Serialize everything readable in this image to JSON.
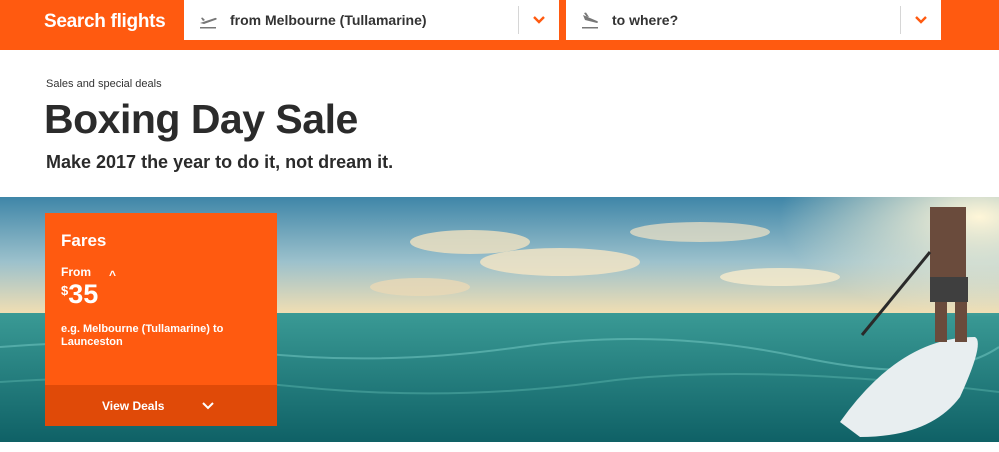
{
  "search": {
    "title": "Search flights",
    "from_value": "from Melbourne (Tullamarine)",
    "to_value": "to where?"
  },
  "page": {
    "breadcrumb": "Sales and special deals",
    "title": "Boxing Day Sale",
    "subtitle": "Make 2017 the year to do it, not dream it."
  },
  "card": {
    "title": "Fares",
    "from_label": "From",
    "caret": "^",
    "currency": "$",
    "price": "35",
    "route": "e.g. Melbourne (Tullamarine) to Launceston",
    "cta": "View Deals"
  },
  "colors": {
    "brand": "#ff5a10",
    "brand_dark": "#e04a08"
  }
}
